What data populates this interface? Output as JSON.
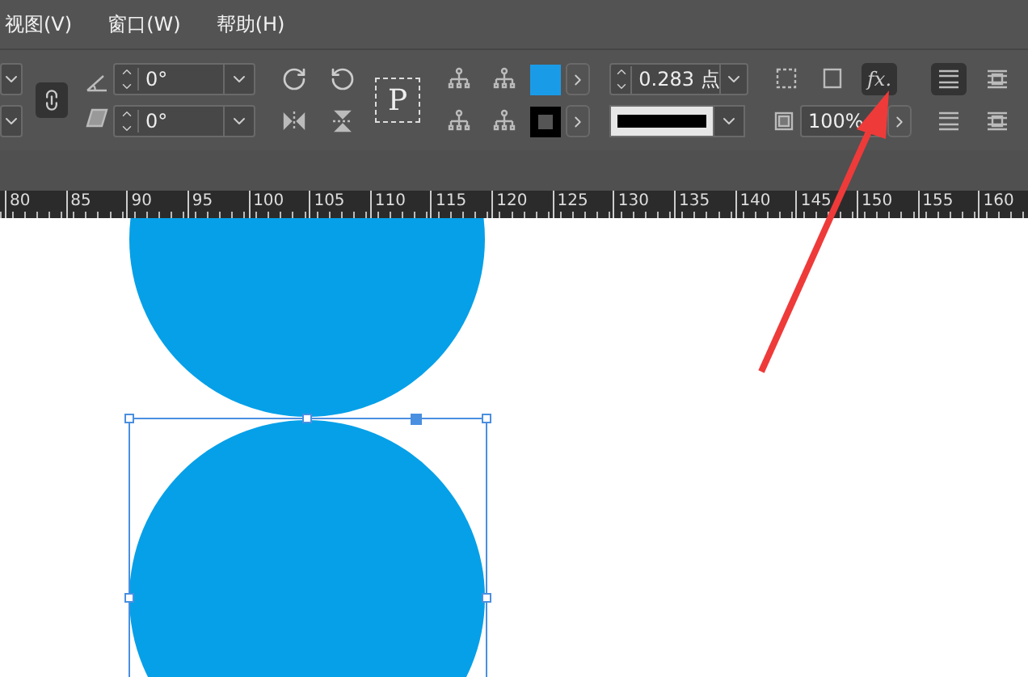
{
  "menu": [
    "视图(V)",
    "窗口(W)",
    "帮助(H)"
  ],
  "control_panel": {
    "rotation": {
      "value": "0°"
    },
    "shear": {
      "value": "0°"
    },
    "frame_label": "P",
    "stroke_weight": {
      "value": "0.283 点"
    },
    "opacity": {
      "value": "100%"
    },
    "effects_button": {
      "label": "fx.",
      "pressed": true
    },
    "wrap_buttons": [
      {
        "selected": true
      },
      {
        "selected": false
      },
      {
        "selected": false
      },
      {
        "selected": false
      }
    ]
  },
  "ruler": [
    "80",
    "85",
    "90",
    "95",
    "100",
    "105",
    "110",
    "115",
    "120",
    "125",
    "130",
    "135",
    "140",
    "145",
    "150",
    "155",
    "160"
  ],
  "canvas": {
    "selection_visible": true
  }
}
